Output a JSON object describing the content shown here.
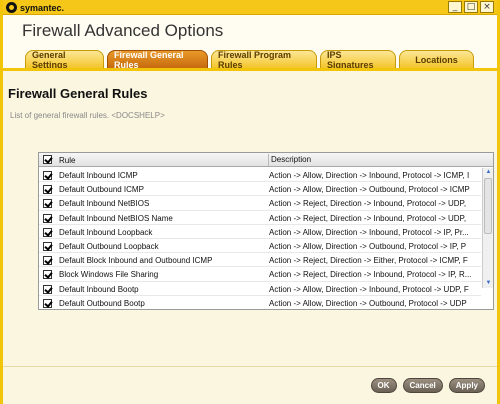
{
  "brand": "symantec.",
  "app_title": "Firewall Advanced Options",
  "window_controls": [
    "_",
    "□",
    "×"
  ],
  "tabs": [
    {
      "label": "General Settings",
      "active": false
    },
    {
      "label": "Firewall General Rules",
      "active": true
    },
    {
      "label": "Firewall Program Rules",
      "active": false
    },
    {
      "label": "IPS Signatures",
      "active": false
    },
    {
      "label": "Locations",
      "active": false
    }
  ],
  "section": {
    "title": "Firewall General Rules",
    "description": "List of general firewall rules. <DOCSHELP>"
  },
  "grid": {
    "columns": {
      "rule": "Rule",
      "description": "Description"
    },
    "rows": [
      {
        "checked": true,
        "rule": "Default Inbound ICMP",
        "description": "Action -> Allow, Direction -> Inbound, Protocol -> ICMP, I"
      },
      {
        "checked": true,
        "rule": "Default Outbound ICMP",
        "description": "Action -> Allow, Direction -> Outbound, Protocol -> ICMP"
      },
      {
        "checked": true,
        "rule": "Default Inbound NetBIOS",
        "description": "Action -> Reject, Direction -> Inbound, Protocol -> UDP,"
      },
      {
        "checked": true,
        "rule": "Default Inbound NetBIOS Name",
        "description": "Action -> Reject, Direction -> Inbound, Protocol -> UDP,"
      },
      {
        "checked": true,
        "rule": "Default Inbound Loopback",
        "description": "Action -> Allow, Direction -> Inbound, Protocol -> IP, Pr..."
      },
      {
        "checked": true,
        "rule": "Default Outbound Loopback",
        "description": "Action -> Allow, Direction -> Outbound, Protocol -> IP, P"
      },
      {
        "checked": true,
        "rule": "Default Block Inbound and Outbound ICMP",
        "description": "Action -> Reject, Direction -> Either, Protocol -> ICMP, F"
      },
      {
        "checked": true,
        "rule": "Block Windows File Sharing",
        "description": "Action -> Reject, Direction -> Inbound, Protocol -> IP, R..."
      },
      {
        "checked": true,
        "rule": "Default Inbound Bootp",
        "description": "Action -> Allow, Direction -> Inbound, Protocol -> UDP, F"
      },
      {
        "checked": true,
        "rule": "Default Outbound Bootp",
        "description": "Action -> Allow, Direction -> Outbound, Protocol -> UDP"
      }
    ]
  },
  "footer": {
    "ok": "OK",
    "cancel": "Cancel",
    "apply": "Apply"
  },
  "colors": {
    "frame": "#f2c40a",
    "active_tab": "#c66a0e",
    "button": "#6b6154"
  }
}
